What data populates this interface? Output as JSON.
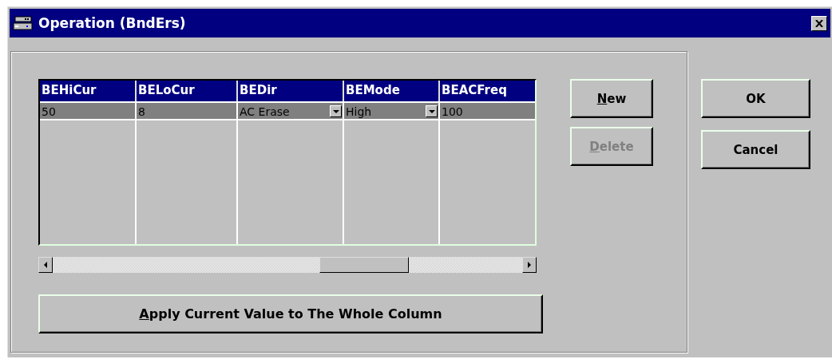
{
  "window": {
    "title": "Operation (BndErs)"
  },
  "grid": {
    "columns": [
      "BEHiCur",
      "BELoCur",
      "BEDir",
      "BEMode",
      "BEACFreq"
    ],
    "rows": [
      {
        "selected": true,
        "cells": [
          {
            "kind": "text",
            "value": "50"
          },
          {
            "kind": "text",
            "value": "8"
          },
          {
            "kind": "dropdown",
            "value": "AC Erase"
          },
          {
            "kind": "dropdown",
            "value": "High"
          },
          {
            "kind": "text",
            "value": "100"
          }
        ]
      }
    ]
  },
  "apply_button": {
    "hotkey": "A",
    "label_rest": "pply Current Value to The Whole Column",
    "disabled": false
  },
  "row_buttons": [
    {
      "hotkey": "N",
      "label_rest": "ew",
      "disabled": false
    },
    {
      "hotkey": "D",
      "label_rest": "elete",
      "disabled": true
    }
  ],
  "dialog_buttons": [
    {
      "label": "OK"
    },
    {
      "label": "Cancel"
    }
  ]
}
